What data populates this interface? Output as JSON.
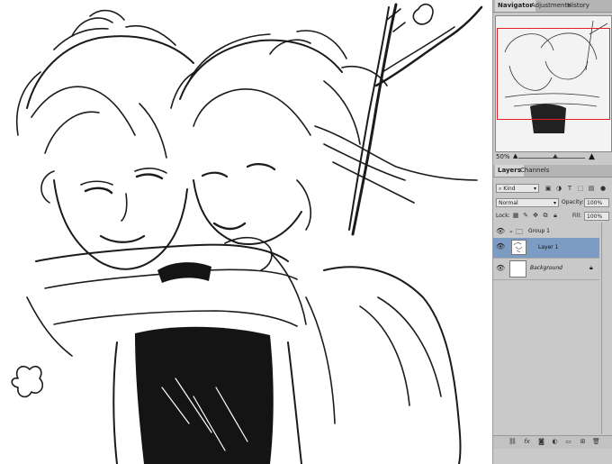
{
  "navigator_tabs": [
    {
      "label": "Navigator",
      "active": true
    },
    {
      "label": "Adjustments",
      "active": false
    },
    {
      "label": "History",
      "active": false
    }
  ],
  "zoom": {
    "value": "50%",
    "slider_fraction": 0.55
  },
  "layers_tabs": [
    {
      "label": "Layers",
      "active": true
    },
    {
      "label": "Channels",
      "active": false
    }
  ],
  "filter": {
    "kind": "Kind"
  },
  "blend": {
    "mode": "Normal",
    "opacity_label": "Opacity:",
    "opacity": "100%"
  },
  "lock": {
    "label": "Lock:",
    "fill_label": "Fill:",
    "fill": "100%"
  },
  "layers": [
    {
      "name": "Group 1",
      "type": "group"
    },
    {
      "name": "Layer 1",
      "type": "layer",
      "selected": true
    },
    {
      "name": "Background",
      "type": "background",
      "locked": true
    }
  ],
  "bottom_icons": [
    "link-icon",
    "fx-icon",
    "mask-icon",
    "adjustment-icon",
    "folder-icon",
    "new-layer-icon",
    "trash-icon"
  ],
  "colors": {
    "panel": "#c9c9c9",
    "selected_layer": "#7d9cc3",
    "nav_box": "#e02020"
  }
}
